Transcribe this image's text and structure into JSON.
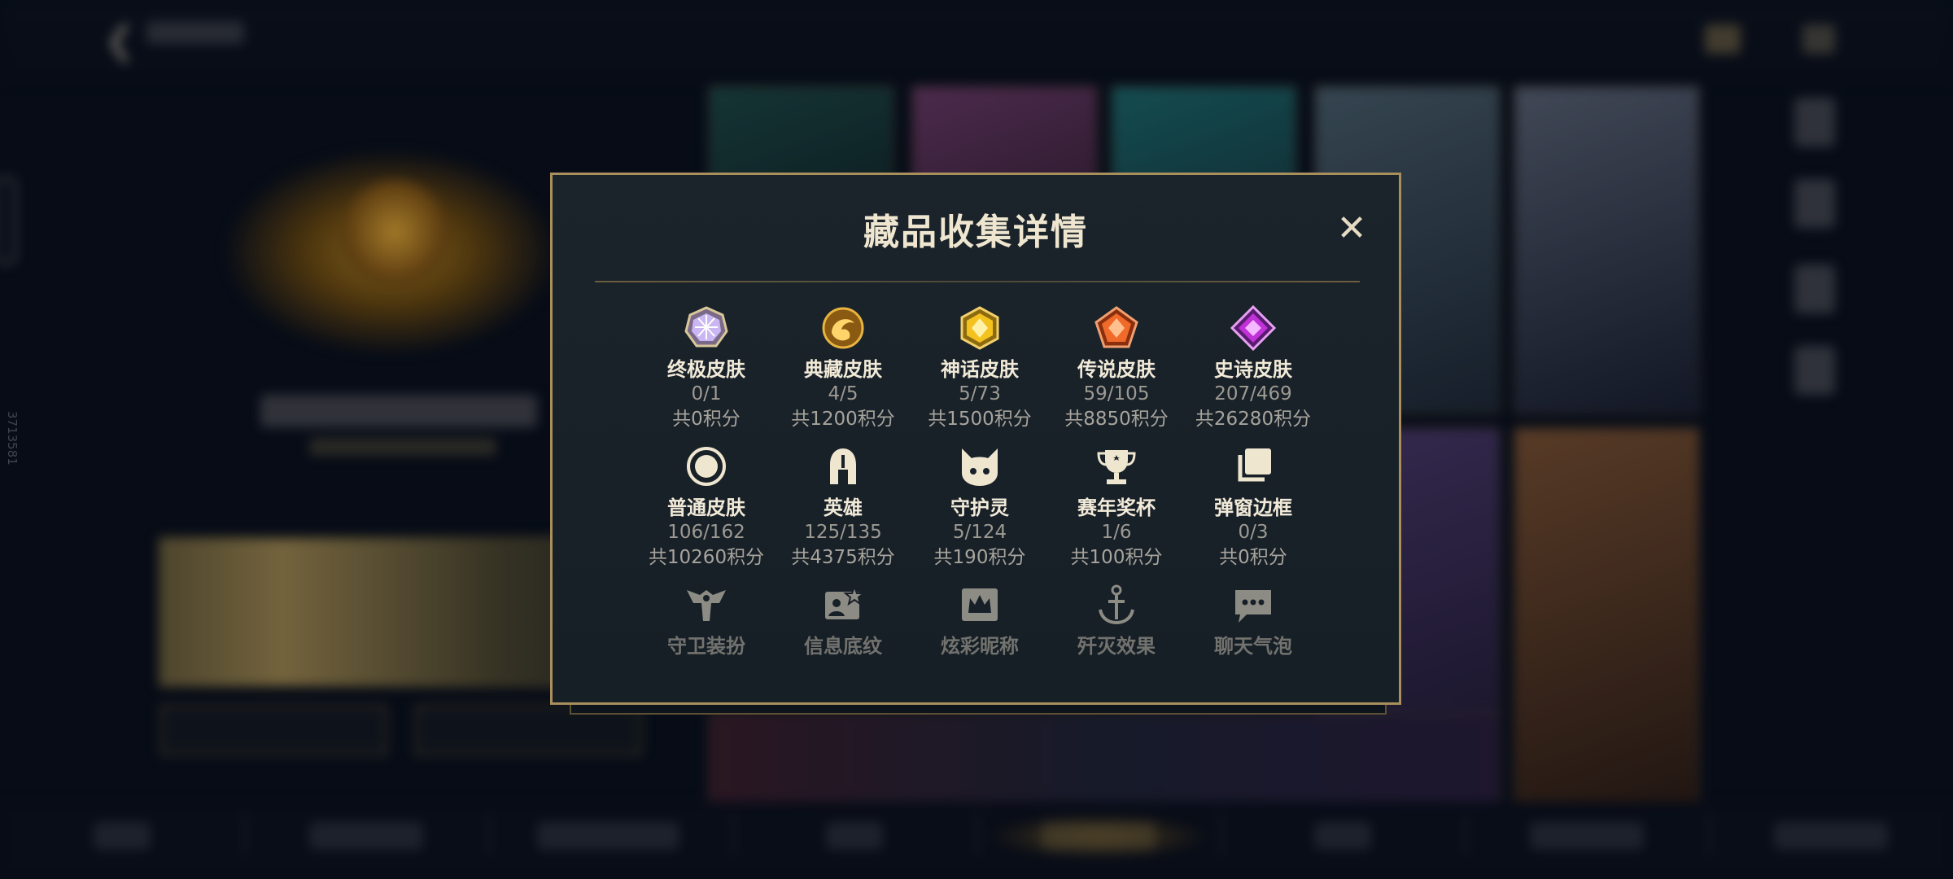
{
  "background": {
    "side_number": "3713581"
  },
  "modal": {
    "title": "藏品收集详情",
    "close_symbol": "✕",
    "rows": [
      [
        {
          "name": "终极皮肤",
          "count": "0/1",
          "score": "共0积分",
          "icon": "ultimate-skin-gem-icon"
        },
        {
          "name": "典藏皮肤",
          "count": "4/5",
          "score": "共1200积分",
          "icon": "prestige-skin-dragon-icon"
        },
        {
          "name": "神话皮肤",
          "count": "5/73",
          "score": "共1500积分",
          "icon": "mythic-skin-gem-icon"
        },
        {
          "name": "传说皮肤",
          "count": "59/105",
          "score": "共8850积分",
          "icon": "legendary-skin-gem-icon"
        },
        {
          "name": "史诗皮肤",
          "count": "207/469",
          "score": "共26280积分",
          "icon": "epic-skin-gem-icon"
        }
      ],
      [
        {
          "name": "普通皮肤",
          "count": "106/162",
          "score": "共10260积分",
          "icon": "normal-skin-circle-icon"
        },
        {
          "name": "英雄",
          "count": "125/135",
          "score": "共4375积分",
          "icon": "hero-helmet-icon"
        },
        {
          "name": "守护灵",
          "count": "5/124",
          "score": "共190积分",
          "icon": "guardian-spirit-icon"
        },
        {
          "name": "赛年奖杯",
          "count": "1/6",
          "score": "共100积分",
          "icon": "season-trophy-icon"
        },
        {
          "name": "弹窗边框",
          "count": "0/3",
          "score": "共0积分",
          "icon": "popup-frame-icon"
        }
      ],
      [
        {
          "name": "守卫装扮",
          "icon": "ward-skin-icon"
        },
        {
          "name": "信息底纹",
          "icon": "info-banner-icon"
        },
        {
          "name": "炫彩昵称",
          "icon": "color-nickname-icon"
        },
        {
          "name": "歼灭效果",
          "icon": "ace-effect-icon"
        },
        {
          "name": "聊天气泡",
          "icon": "chat-bubble-icon"
        }
      ]
    ]
  },
  "colors": {
    "modal_border": "#a88f5c",
    "modal_bg": "#18202a",
    "title_text": "#efe6d0",
    "secondary_text": "#9d9a92"
  }
}
